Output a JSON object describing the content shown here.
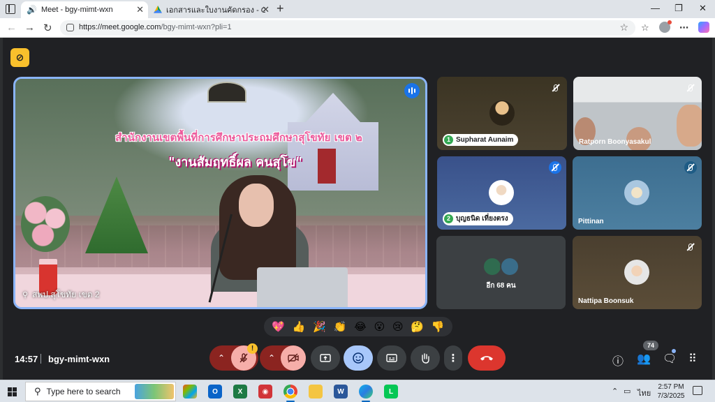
{
  "browser": {
    "tabs": [
      {
        "title": "Meet - bgy-mimt-wxn",
        "active": true
      },
      {
        "title": "เอกสารและใบงานคัดกรอง - Google ไ",
        "active": false
      }
    ],
    "new_tab": "+",
    "close": "✕",
    "window_controls": {
      "minimize": "—",
      "maximize": "❐",
      "close": "✕"
    },
    "url_host": "https://meet.google.com",
    "url_path": "/bgy-mimt-wxn?pli=1"
  },
  "meet": {
    "main_video": {
      "banner_line1": "สำนักงานเขตพื้นที่การศึกษาประถมศึกษาสุโขทัย เขต ๒",
      "banner_line2": "\"งานสัมฤทธิ์ผล คนสุโข\"",
      "name": "สพป.สุโขทัย เขต 2"
    },
    "tiles": [
      {
        "name": "Supharat Aunaim",
        "badge": "1"
      },
      {
        "name": "Ratporn Boonyasakul"
      },
      {
        "name": "บุญธนิด เที่ยงตรง",
        "badge": "2"
      },
      {
        "name": "Pittinan"
      },
      {
        "more": "อีก 68 คน"
      },
      {
        "name": "Nattipa Boonsuk"
      }
    ],
    "reactions": [
      "💖",
      "👍",
      "🎉",
      "👏",
      "😂",
      "😮",
      "😢",
      "🤔",
      "👎"
    ],
    "time": "14:57",
    "meeting_code": "bgy-mimt-wxn",
    "participant_count": "74",
    "warning_mark": "!"
  },
  "taskbar": {
    "search_placeholder": "Type here to search",
    "language": "ไทย",
    "time": "2:57 PM",
    "date": "7/3/2025"
  },
  "colors": {
    "accent": "#8ab4f8",
    "hangup": "#dc362e",
    "mic_off": "#f6aea9"
  }
}
